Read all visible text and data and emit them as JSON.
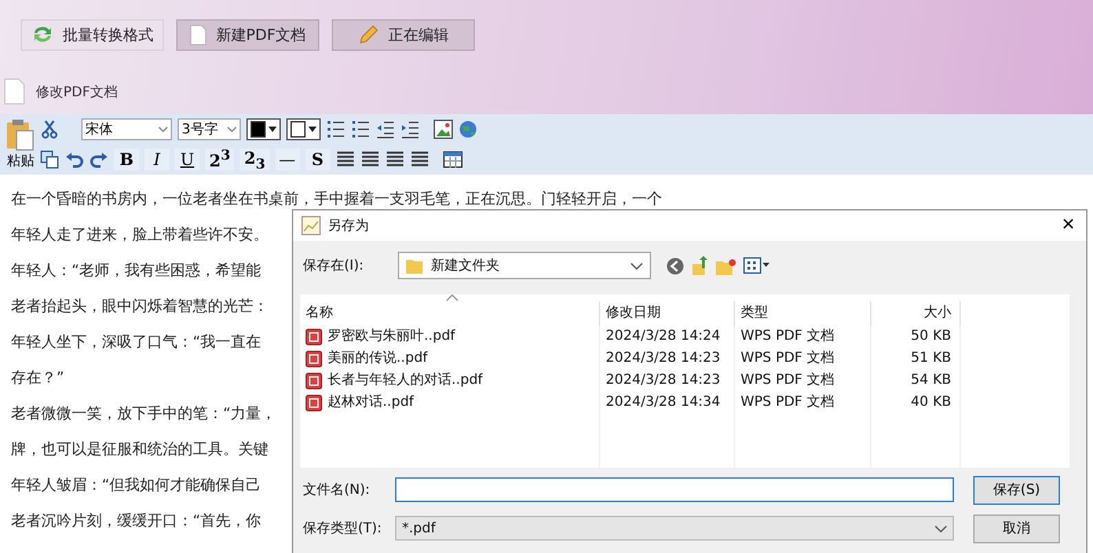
{
  "top_buttons": [
    {
      "kind": "convert",
      "label": "批量转换格式",
      "selected": true
    },
    {
      "kind": "new",
      "label": "新建PDF文档",
      "selected": false
    },
    {
      "kind": "edit",
      "label": "正在编辑",
      "selected": false
    }
  ],
  "doc_title": "修改PDF文档",
  "toolbar": {
    "paste_label": "粘贴",
    "font": "宋体",
    "size": "3号字",
    "format_buttons": [
      {
        "kind": "bold",
        "label": "B"
      },
      {
        "kind": "italic",
        "label": "I"
      },
      {
        "kind": "underline",
        "label": "U"
      },
      {
        "kind": "script",
        "label": "2$^{3}$"
      },
      {
        "kind": "script",
        "label": "2$_{3}$"
      },
      {
        "kind": "plain",
        "label": "—"
      },
      {
        "kind": "strike",
        "label": "S"
      }
    ]
  },
  "document_lines": [
    "在一个昏暗的书房内，一位老者坐在书桌前，手中握着一支羽毛笔，正在沉思。门轻轻开启，一个",
    "年轻人走了进来，脸上带着些许不安。",
    "年轻人：“老师，我有些困惑，希望能",
    "老者抬起头，眼中闪烁着智慧的光芒：",
    "年轻人坐下，深吸了口气：“我一直在",
    "存在？”",
    "老者微微一笑，放下手中的笔：“力量，",
    "牌，也可以是征服和统治的工具。关键",
    "年轻人皱眉：“但我如何才能确保自己",
    "老者沉吟片刻，缓缓开口：“首先，你"
  ],
  "dialog": {
    "title": "另存为",
    "close": "×",
    "save_in_label": "保存在(I):",
    "folder": "新建文件夹",
    "columns": [
      "名称",
      "修改日期",
      "类型",
      "大小"
    ],
    "files": [
      {
        "name": "罗密欧与朱丽叶..pdf",
        "date": "2024/3/28 14:24",
        "type": "WPS PDF 文档",
        "size": "50 KB"
      },
      {
        "name": "美丽的传说..pdf",
        "date": "2024/3/28 14:23",
        "type": "WPS PDF 文档",
        "size": "51 KB"
      },
      {
        "name": "长者与年轻人的对话..pdf",
        "date": "2024/3/28 14:23",
        "type": "WPS PDF 文档",
        "size": "54 KB"
      },
      {
        "name": "赵林对话..pdf",
        "date": "2024/3/28 14:34",
        "type": "WPS PDF 文档",
        "size": "40 KB"
      }
    ],
    "filename_label": "文件名(N):",
    "filetype_label": "保存类型(T):",
    "filetype": "*.pdf",
    "save_button": "保存(S)",
    "cancel_button": "取消"
  }
}
